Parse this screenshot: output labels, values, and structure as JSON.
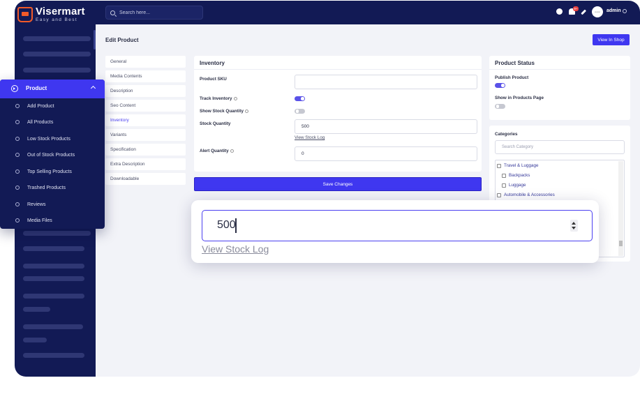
{
  "brand": {
    "name": "Visermart",
    "tagline": "Easy and Best"
  },
  "topbar": {
    "search_placeholder": "Search here...",
    "notifications_count": "9+",
    "user_name": "admin",
    "avatar_text": "avatar"
  },
  "page": {
    "title": "Edit Product",
    "view_in_shop": "View In Shop"
  },
  "tabs": [
    "General",
    "Media Contents",
    "Description",
    "Seo Content",
    "Inventory",
    "Variants",
    "Specification",
    "Extra Description",
    "Downloadable"
  ],
  "active_tab": "Inventory",
  "inventory": {
    "title": "Inventory",
    "sku_label": "Product SKU",
    "sku_value": "",
    "track_label": "Track Inventory",
    "track_on": true,
    "show_stock_label": "Show Stock Quantity",
    "show_stock_on": false,
    "stock_label": "Stock Quantity",
    "stock_value": "500",
    "view_log": "View Stock Log",
    "alert_label": "Alert Quantity",
    "alert_value": "0"
  },
  "save_button": "Save Changes",
  "status": {
    "title": "Product Status",
    "publish_label": "Publish Product",
    "publish_on": true,
    "show_in_page_label": "Show in Products Page",
    "show_in_page_on": false
  },
  "categories": {
    "title": "Categories",
    "search_placeholder": "Search Category",
    "items": [
      {
        "label": "Travel & Luggage",
        "level": 0
      },
      {
        "label": "Backpacks",
        "level": 1
      },
      {
        "label": "Luggage",
        "level": 1
      },
      {
        "label": "Automobile & Accessories",
        "level": 0
      }
    ]
  },
  "flyout": {
    "title": "Product",
    "items": [
      "Add Product",
      "All Products",
      "Low Stock Products",
      "Out of Stock Products",
      "Top Selling Products",
      "Trashed Products",
      "Reviews",
      "Media Files"
    ]
  },
  "zoom": {
    "value": "500",
    "link": "View Stock Log"
  },
  "colors": {
    "sidebar": "#121a55",
    "accent": "#3f37f0",
    "background": "#f2f3f8"
  }
}
